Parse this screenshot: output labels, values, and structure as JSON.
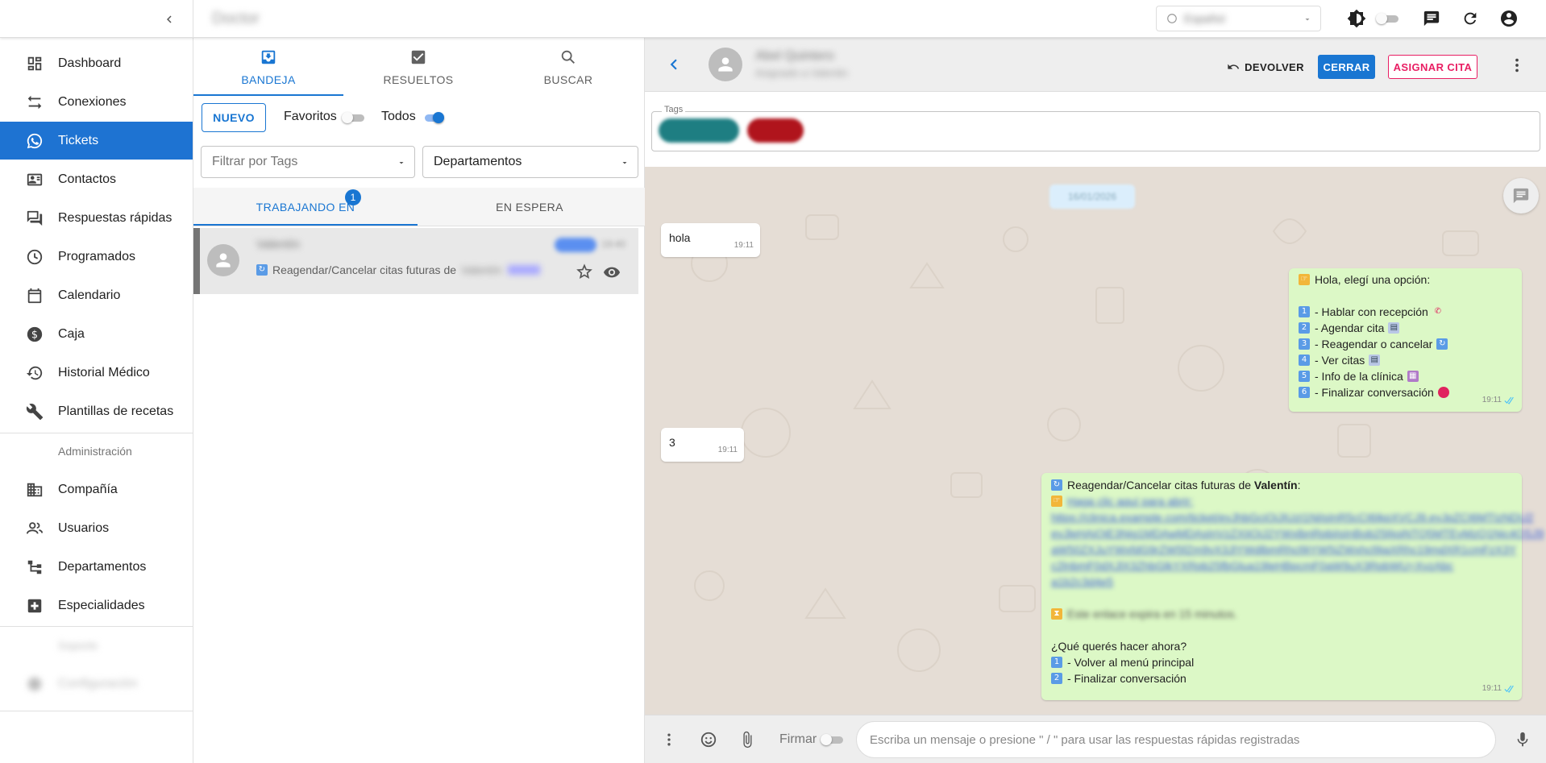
{
  "appbar": {
    "title": "Doctor",
    "language": "Español",
    "icons": [
      "chevron-left-icon",
      "brightness-icon",
      "chat-icon",
      "refresh-icon",
      "account-icon"
    ]
  },
  "sidebar": {
    "items": [
      {
        "label": "Dashboard",
        "icon": "dashboard-icon"
      },
      {
        "label": "Conexiones",
        "icon": "swap-icon"
      },
      {
        "label": "Tickets",
        "icon": "whatsapp-icon",
        "active": true
      },
      {
        "label": "Contactos",
        "icon": "contact-card-icon"
      },
      {
        "label": "Respuestas rápidas",
        "icon": "quick-reply-icon"
      },
      {
        "label": "Programados",
        "icon": "clock-icon"
      },
      {
        "label": "Calendario",
        "icon": "calendar-icon"
      },
      {
        "label": "Caja",
        "icon": "dollar-icon"
      },
      {
        "label": "Historial Médico",
        "icon": "history-icon"
      },
      {
        "label": "Plantillas de recetas",
        "icon": "wrench-icon"
      }
    ],
    "admin_header": "Administración",
    "admin_items": [
      {
        "label": "Compañía",
        "icon": "building-icon"
      },
      {
        "label": "Usuarios",
        "icon": "users-icon"
      },
      {
        "label": "Departamentos",
        "icon": "hierarchy-icon"
      },
      {
        "label": "Especialidades",
        "icon": "medical-plus-icon"
      }
    ],
    "section_blurred": "Soporte",
    "config_blurred": "Configuración"
  },
  "tickets": {
    "tabs": [
      {
        "label": "BANDEJA",
        "icon": "inbox-icon",
        "active": true
      },
      {
        "label": "RESUELTOS",
        "icon": "check-box-icon"
      },
      {
        "label": "BUSCAR",
        "icon": "search-icon"
      }
    ],
    "new_button": "NUEVO",
    "favorites_label": "Favoritos",
    "favorites_on": false,
    "all_label": "Todos",
    "all_on": true,
    "tag_filter_placeholder": "Filtrar por Tags",
    "departments_select": "Departamentos",
    "subtabs": [
      {
        "label": "TRABAJANDO EN",
        "badge": "1",
        "active": true
      },
      {
        "label": "EN ESPERA"
      }
    ],
    "list": [
      {
        "name": "Valentín",
        "time": "19:40",
        "preview": "Reagendar/Cancelar citas futuras de"
      }
    ]
  },
  "chat": {
    "contact_name": "Abel Quintero",
    "contact_sub": "Asignado a Valentin",
    "return_label": "DEVOLVER",
    "close_label": "CERRAR",
    "assign_label": "ASIGNAR CITA",
    "tags_label": "Tags",
    "date_pill": "16/01/2026",
    "messages": [
      {
        "dir": "in",
        "text": "hola",
        "time": "19:11"
      },
      {
        "dir": "out",
        "time": "19:11",
        "lines": [
          "Hola, elegí una opción:",
          "",
          "- Hablar con recepción",
          "- Agendar cita",
          "- Reagendar o cancelar",
          "- Ver citas",
          "- Info de la clínica",
          "- Finalizar conversación"
        ]
      },
      {
        "dir": "in",
        "text": "3",
        "time": "19:11"
      },
      {
        "dir": "out",
        "time": "19:11",
        "title_prefix": "Reagendar/Cancelar citas futuras de ",
        "title_bold": "Valentín",
        "title_suffix": ":",
        "question": "¿Qué querés hacer ahora?",
        "options": [
          "- Volver al menú principal",
          "- Finalizar conversación"
        ]
      }
    ]
  },
  "composer": {
    "firmar_label": "Firmar",
    "placeholder": "Escriba un mensaje o presione \" / \" para usar las respuestas rápidas registradas"
  },
  "colors": {
    "primary": "#1976d2",
    "sidebar_active": "#1e73d2",
    "assign_border": "#e91e63",
    "bubble_out": "#dcf8c6",
    "chat_bg": "#e5ddd5"
  }
}
